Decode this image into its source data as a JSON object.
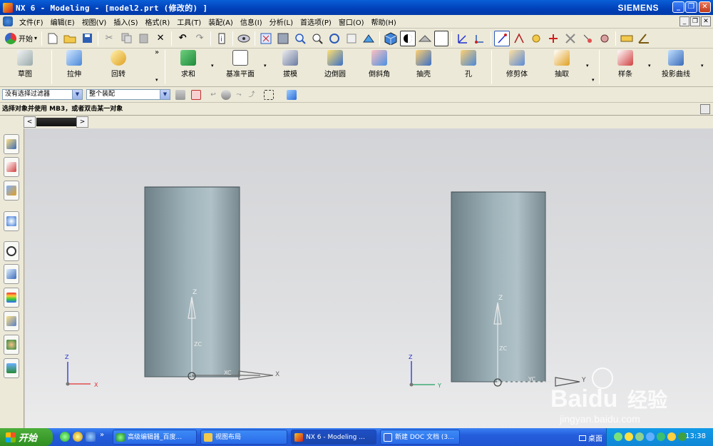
{
  "window": {
    "title": "NX 6 - Modeling - [model2.prt  (修改的) ]",
    "brand": "SIEMENS",
    "minimize": "_",
    "restore": "❐",
    "close": "✕"
  },
  "menu": {
    "items": [
      "文件(F)",
      "编辑(E)",
      "视图(V)",
      "插入(S)",
      "格式(R)",
      "工具(T)",
      "装配(A)",
      "信息(I)",
      "分析(L)",
      "首选项(P)",
      "窗口(O)",
      "帮助(H)"
    ]
  },
  "toolbar1": {
    "start_label": "开始",
    "start_arrow": "▾"
  },
  "toolbar2": {
    "tools": [
      "草图",
      "拉伸",
      "回转",
      "求和",
      "基准平面",
      "拔模",
      "边倒圆",
      "倒斜角",
      "抽壳",
      "孔",
      "修剪体",
      "抽取",
      "样条",
      "投影曲线"
    ],
    "more": "»",
    "dd": "▾"
  },
  "filterbar": {
    "filter_value": "没有选择过滤器",
    "scope_value": "整个装配",
    "arrow": "▼"
  },
  "cue": {
    "text": "选择对象并使用 MB3，或者双击某一对象"
  },
  "tabs": {
    "left": "<",
    "right": ">"
  },
  "scene": {
    "left": {
      "z": "Z",
      "zc": "ZC",
      "xc": "XC",
      "x": "X",
      "tz": "Z",
      "tx": "X"
    },
    "right": {
      "z": "Z",
      "zc": "ZC",
      "yc": "YC",
      "y": "Y",
      "tz": "Z",
      "ty": "Y"
    }
  },
  "watermark": {
    "brand": "Baidu",
    "cn": "经验",
    "url": "jingyan.baidu.com"
  },
  "taskbar": {
    "start": "开始",
    "more": "»",
    "tasks": [
      "高级编辑器_百度...",
      "视图布局",
      "NX 6 - Modeling ...",
      "新建 DOC 文档 (3..."
    ],
    "desktop": "桌面",
    "clock": "13:38"
  },
  "colors": {
    "titlebar": "#0a5fd8",
    "viewport": "#dedfe1",
    "cylinder": "#8fa5ad",
    "axis_x": "#e03030",
    "axis_y": "#20a060",
    "axis_z": "#2030d0"
  }
}
